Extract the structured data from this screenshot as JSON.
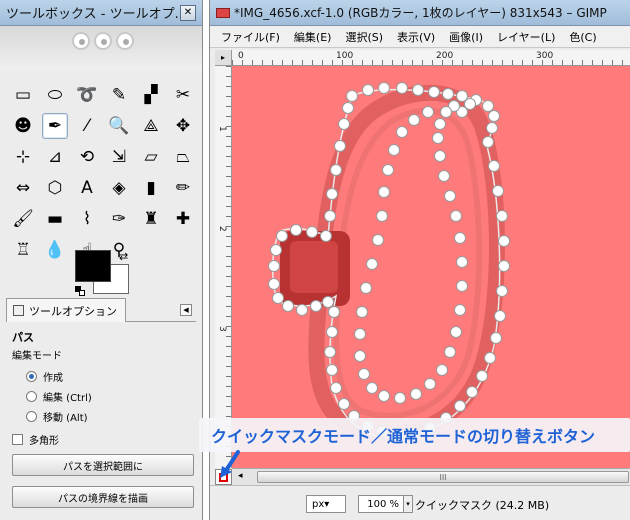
{
  "toolbox": {
    "title": "ツールボックス - ツールオプ...",
    "close_glyph": "✕",
    "tools": [
      {
        "name": "rect-select-icon",
        "glyph": "▭"
      },
      {
        "name": "ellipse-select-icon",
        "glyph": "⬭"
      },
      {
        "name": "free-select-icon",
        "glyph": "➰"
      },
      {
        "name": "fuzzy-select-icon",
        "glyph": "✎"
      },
      {
        "name": "select-by-color-icon",
        "glyph": "▞"
      },
      {
        "name": "scissors-select-icon",
        "glyph": "✂"
      },
      {
        "name": "foreground-select-icon",
        "glyph": "☻"
      },
      {
        "name": "paths-icon",
        "glyph": "✒"
      },
      {
        "name": "color-picker-icon",
        "glyph": "⁄"
      },
      {
        "name": "magnify-icon",
        "glyph": "🔍"
      },
      {
        "name": "measure-icon",
        "glyph": "⟁"
      },
      {
        "name": "move-icon",
        "glyph": "✥"
      },
      {
        "name": "align-icon",
        "glyph": "⊹"
      },
      {
        "name": "crop-icon",
        "glyph": "⊿"
      },
      {
        "name": "rotate-icon",
        "glyph": "⟲"
      },
      {
        "name": "scale-icon",
        "glyph": "⇲"
      },
      {
        "name": "shear-icon",
        "glyph": "▱"
      },
      {
        "name": "perspective-icon",
        "glyph": "⏢"
      },
      {
        "name": "flip-icon",
        "glyph": "⇔"
      },
      {
        "name": "cage-transform-icon",
        "glyph": "⬡"
      },
      {
        "name": "text-icon",
        "glyph": "A"
      },
      {
        "name": "bucket-fill-icon",
        "glyph": "◈"
      },
      {
        "name": "blend-icon",
        "glyph": "▮"
      },
      {
        "name": "pencil-icon",
        "glyph": "✏"
      },
      {
        "name": "paintbrush-icon",
        "glyph": "🖌"
      },
      {
        "name": "eraser-icon",
        "glyph": "▬"
      },
      {
        "name": "airbrush-icon",
        "glyph": "⌇"
      },
      {
        "name": "ink-icon",
        "glyph": "✑"
      },
      {
        "name": "clone-icon",
        "glyph": "♜"
      },
      {
        "name": "heal-icon",
        "glyph": "✚"
      },
      {
        "name": "perspective-clone-icon",
        "glyph": "♖"
      },
      {
        "name": "blur-sharpen-icon",
        "glyph": "💧"
      },
      {
        "name": "smudge-icon",
        "glyph": "☝"
      },
      {
        "name": "dodge-burn-icon",
        "glyph": "⚲"
      }
    ],
    "colors": {
      "foreground": "#000000",
      "background": "#ffffff"
    },
    "options_tab": "ツールオプション",
    "tab_menu_glyph": "◀",
    "options": {
      "title": "パス",
      "edit_mode_label": "編集モード",
      "modes": [
        {
          "label": "作成",
          "selected": true
        },
        {
          "label": "編集 (Ctrl)",
          "selected": false
        },
        {
          "label": "移動 (Alt)",
          "selected": false
        }
      ],
      "polygon_label": "多角形",
      "polygon_checked": false,
      "button_to_selection": "パスを選択範囲に",
      "button_stroke": "パスの境界線を描画"
    }
  },
  "image_window": {
    "title": "*IMG_4656.xcf-1.0 (RGBカラー, 1枚のレイヤー) 831x543 – GIMP",
    "menus": [
      "ファイル(F)",
      "編集(E)",
      "選択(S)",
      "表示(V)",
      "画像(I)",
      "レイヤー(L)",
      "色(C)"
    ],
    "ruler_corner_glyph": "▸",
    "ruler_top_labels": [
      "0",
      "100",
      "200",
      "300"
    ],
    "ruler_left_labels": [
      "1",
      "2",
      "3"
    ],
    "canvas_color": "#ff7b7b",
    "scrollbar_grip": "III",
    "scroll_left_glyph": "◂",
    "unit": "px▾",
    "zoom": "100 %",
    "zoom_arrow_glyph": "▾",
    "status": "クイックマスク (24.2 MB)"
  },
  "callout": {
    "text": "クイックマスクモード／通常モードの切り替えボタン",
    "color": "#1f62d6"
  }
}
